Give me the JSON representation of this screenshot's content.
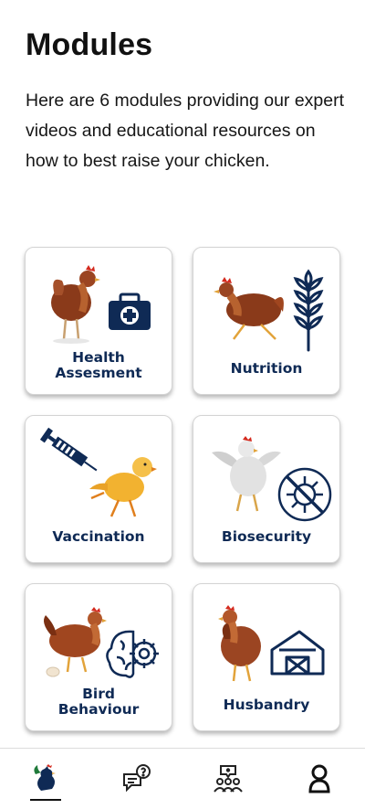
{
  "page": {
    "title": "Modules",
    "intro": "Here are 6 modules providing our expert videos and educational resources on how to best raise your chicken."
  },
  "modules": [
    {
      "label_line1": "Health",
      "label_line2": "Assesment",
      "icon": "first-aid-kit-icon"
    },
    {
      "label_line1": "Nutrition",
      "label_line2": "",
      "icon": "wheat-icon"
    },
    {
      "label_line1": "Vaccination",
      "label_line2": "",
      "icon": "syringe-icon"
    },
    {
      "label_line1": "Biosecurity",
      "label_line2": "",
      "icon": "virus-blocked-icon"
    },
    {
      "label_line1": "Bird",
      "label_line2": "Behaviour",
      "icon": "brain-gear-icon"
    },
    {
      "label_line1": "Husbandry",
      "label_line2": "",
      "icon": "barn-icon"
    }
  ],
  "bottom_nav": {
    "items": [
      "rooster-icon",
      "chat-question-icon",
      "community-icon",
      "profile-icon"
    ],
    "active_index": 0
  },
  "colors": {
    "icon_navy": "#0f2a55",
    "hen_brown": "#8a3a1a",
    "chick_yellow": "#f2b230"
  }
}
